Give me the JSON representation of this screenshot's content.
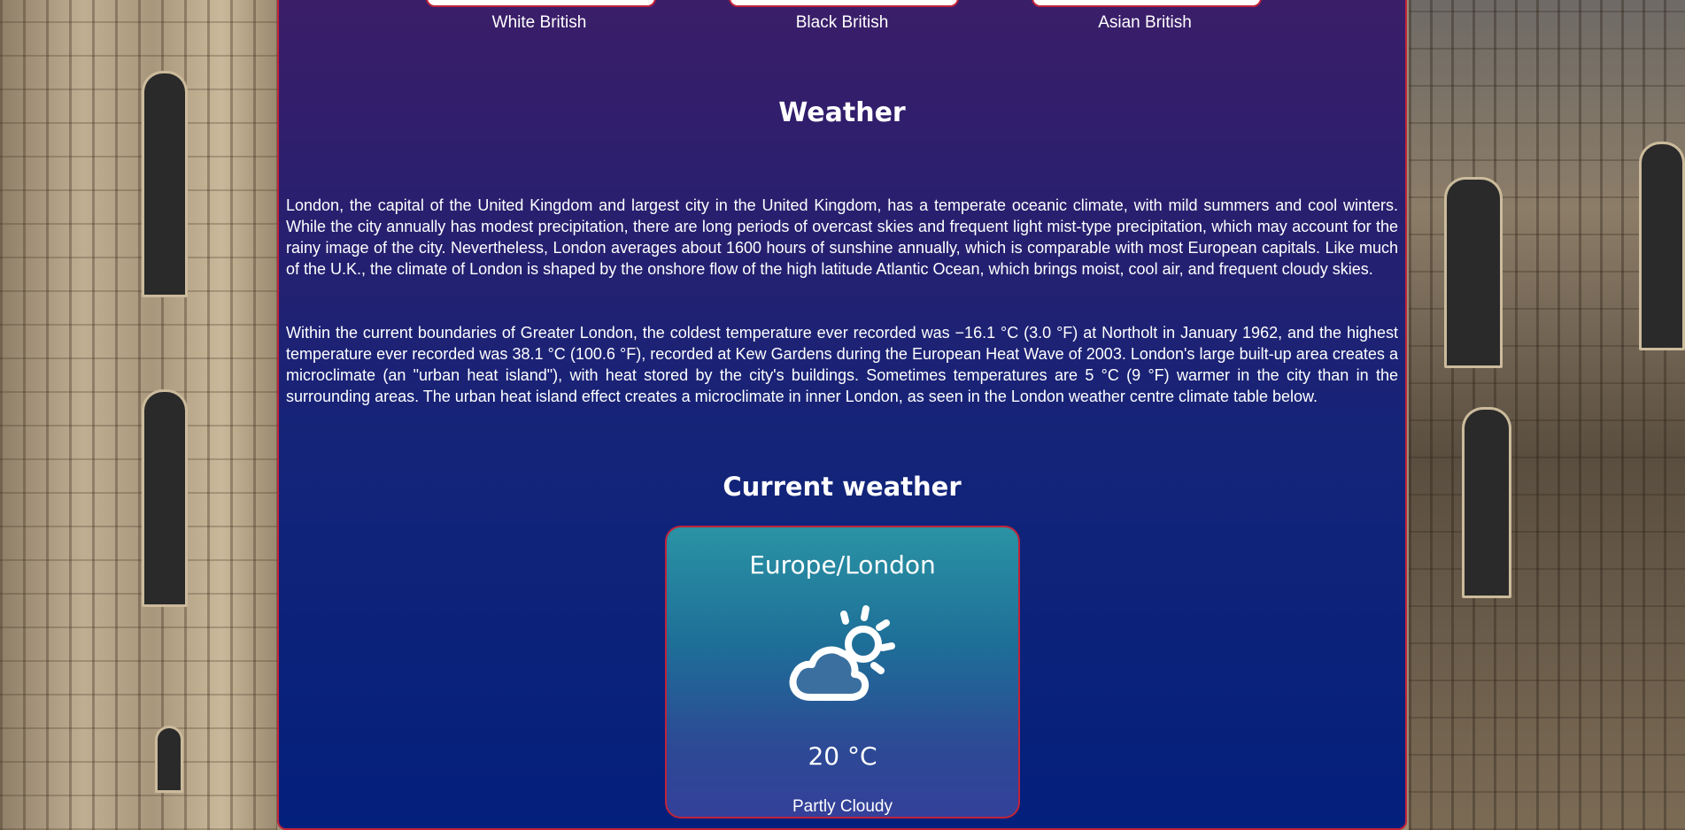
{
  "ethnic_groups": [
    {
      "label": "White British"
    },
    {
      "label": "Black British"
    },
    {
      "label": "Asian British"
    }
  ],
  "weather_section": {
    "heading": "Weather",
    "paragraphs": [
      "London, the capital of the United Kingdom and largest city in the United Kingdom, has a temperate oceanic climate, with mild summers and cool winters. While the city annually has modest precipitation, there are long periods of overcast skies and frequent light mist-type precipitation, which may account for the rainy image of the city. Nevertheless, London averages about 1600 hours of sunshine annually, which is comparable with most European capitals. Like much of the U.K., the climate of London is shaped by the onshore flow of the high latitude Atlantic Ocean, which brings moist, cool air, and frequent cloudy skies.",
      "Within the current boundaries of Greater London, the coldest temperature ever recorded was −16.1 °C (3.0 °F) at Northolt in January 1962, and the highest temperature ever recorded was 38.1 °C (100.6 °F), recorded at Kew Gardens during the European Heat Wave of 2003. London's large built-up area creates a microclimate (an \"urban heat island\"), with heat stored by the city's buildings. Sometimes temperatures are 5 °C (9 °F) warmer in the city than in the surrounding areas. The urban heat island effect creates a microclimate in inner London, as seen in the London weather centre climate table below."
    ]
  },
  "current_weather": {
    "heading": "Current weather",
    "city": "Europe/London",
    "icon": "partly-cloudy-icon",
    "temperature": "20 °C",
    "condition": "Partly Cloudy"
  },
  "colors": {
    "accent_border": "#c0233a",
    "panel_top": "#3c1e68",
    "panel_bottom": "#03207c",
    "card_top": "#2a93a4",
    "card_bottom": "#344099"
  }
}
